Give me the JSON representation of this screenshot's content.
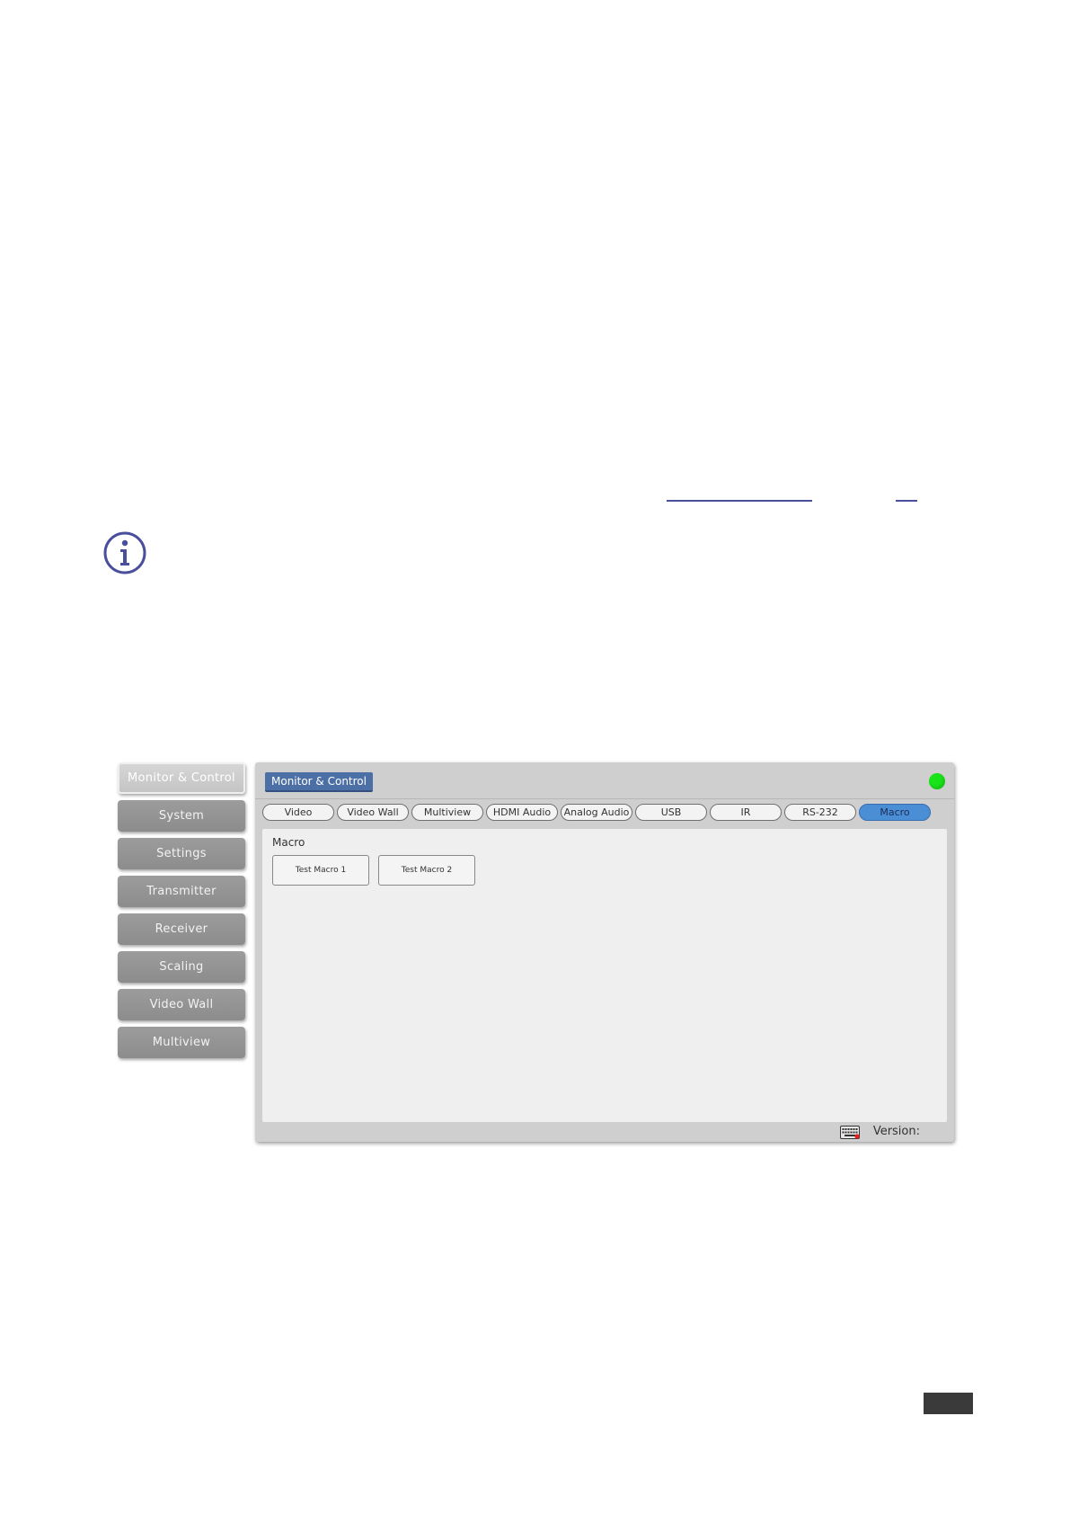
{
  "sidebar": {
    "items": [
      {
        "label": "Monitor & Control",
        "active": true
      },
      {
        "label": "System"
      },
      {
        "label": "Settings"
      },
      {
        "label": "Transmitter"
      },
      {
        "label": "Receiver"
      },
      {
        "label": "Scaling"
      },
      {
        "label": "Video Wall"
      },
      {
        "label": "Multiview"
      }
    ]
  },
  "header": {
    "title": "Monitor & Control",
    "status_color": "#19e319"
  },
  "tabs": [
    {
      "label": "Video"
    },
    {
      "label": "Video Wall"
    },
    {
      "label": "Multiview"
    },
    {
      "label": "HDMI Audio"
    },
    {
      "label": "Analog Audio"
    },
    {
      "label": "USB"
    },
    {
      "label": "IR"
    },
    {
      "label": "RS-232"
    },
    {
      "label": "Macro",
      "active": true
    }
  ],
  "content": {
    "section_label": "Macro",
    "macros": [
      {
        "label": "Test Macro 1"
      },
      {
        "label": "Test Macro 2"
      }
    ]
  },
  "footer": {
    "version_label": "Version:",
    "keyboard_icon": "keyboard-icon"
  },
  "colors": {
    "accent": "#4c6fa6",
    "active_tab": "#4a8fd6",
    "icon": "#4a4f9c"
  }
}
